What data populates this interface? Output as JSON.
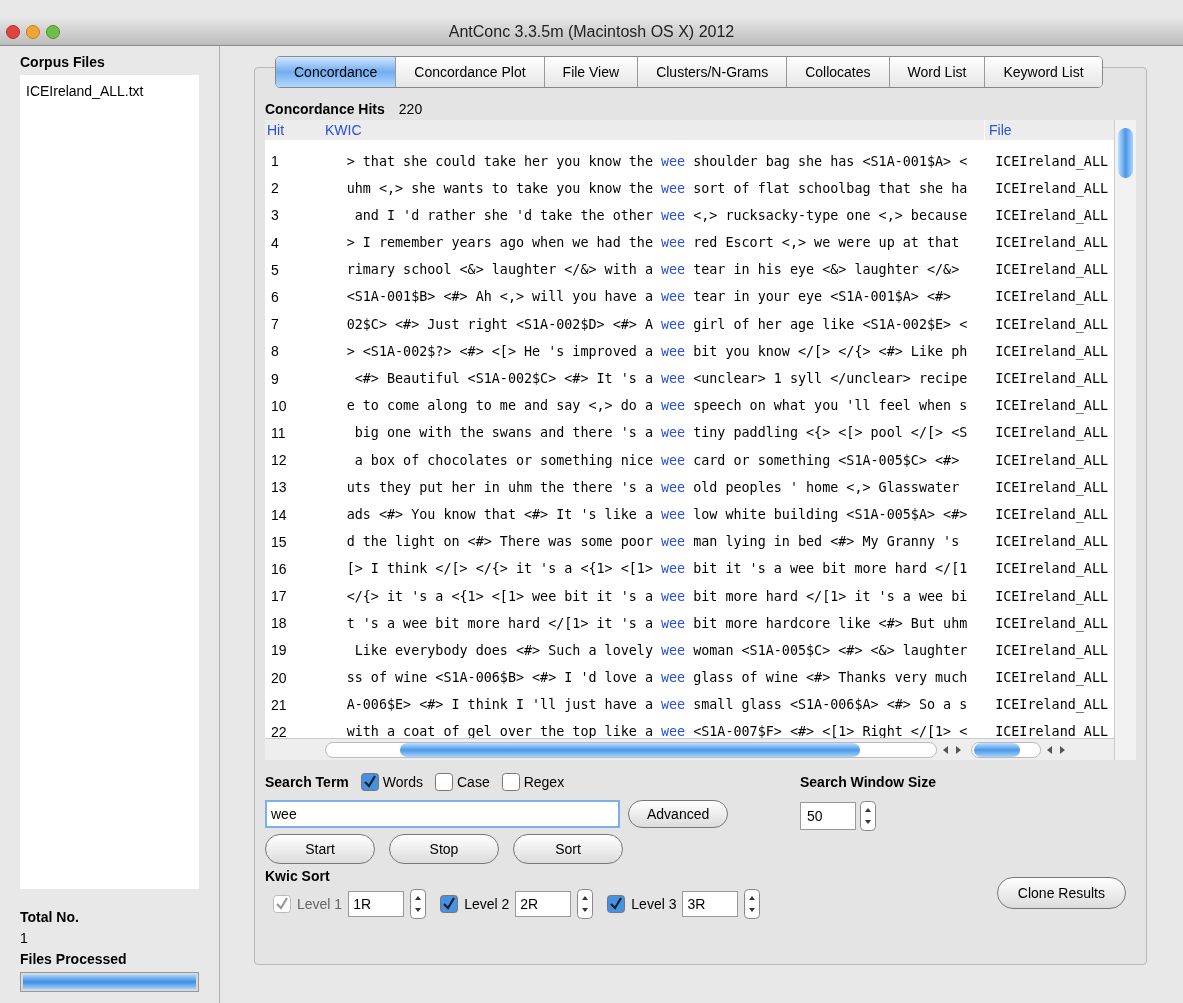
{
  "window": {
    "title": "AntConc 3.3.5m (Macintosh OS X) 2012"
  },
  "sidebar": {
    "title": "Corpus Files",
    "files": [
      {
        "name": "ICEIreland_ALL.txt",
        "selected": false
      }
    ],
    "total_label": "Total No.",
    "total_value": "1",
    "processed_label": "Files Processed",
    "progress": {
      "level": 1
    }
  },
  "tabs": [
    {
      "label": "Concordance",
      "selected": true
    },
    {
      "label": "Concordance Plot",
      "selected": false
    },
    {
      "label": "File View",
      "selected": false
    },
    {
      "label": "Clusters/N-Grams",
      "selected": false
    },
    {
      "label": "Collocates",
      "selected": false
    },
    {
      "label": "Word List",
      "selected": false
    },
    {
      "label": "Keyword List",
      "selected": false
    }
  ],
  "hits": {
    "label": "Concordance Hits",
    "value": "220"
  },
  "table": {
    "columns": [
      "Hit",
      "KWIC",
      "File"
    ],
    "rows": [
      {
        "hit": "1",
        "left": "> that she could take her you know the",
        "keyword": "wee",
        "right": "shoulder bag she has <S1A-001$A> <",
        "file": "ICEIreland_ALL"
      },
      {
        "hit": "2",
        "left": "uhm <,> she wants to take you know the",
        "keyword": "wee",
        "right": "sort of flat schoolbag that she ha",
        "file": "ICEIreland_ALL"
      },
      {
        "hit": "3",
        "left": " and I 'd rather she 'd take the other",
        "keyword": "wee",
        "right": "<,> rucksacky-type one <,> because",
        "file": "ICEIreland_ALL"
      },
      {
        "hit": "4",
        "left": "> I remember years ago when we had the",
        "keyword": "wee",
        "right": "red Escort <,> we were up at that",
        "file": "ICEIreland_ALL"
      },
      {
        "hit": "5",
        "left": "rimary school <&> laughter </&> with a",
        "keyword": "wee",
        "right": "tear in his eye <&> laughter </&>",
        "file": "ICEIreland_ALL"
      },
      {
        "hit": "6",
        "left": "<S1A-001$B> <#> Ah <,> will you have a",
        "keyword": "wee",
        "right": "tear in your eye <S1A-001$A> <#>",
        "file": "ICEIreland_ALL"
      },
      {
        "hit": "7",
        "left": "02$C> <#> Just right <S1A-002$D> <#> A",
        "keyword": "wee",
        "right": "girl of her age like <S1A-002$E> <",
        "file": "ICEIreland_ALL"
      },
      {
        "hit": "8",
        "left": "> <S1A-002$?> <#> <[> He 's improved a",
        "keyword": "wee",
        "right": "bit you know </[> </{> <#> Like ph",
        "file": "ICEIreland_ALL"
      },
      {
        "hit": "9",
        "left": " <#> Beautiful <S1A-002$C> <#> It 's a",
        "keyword": "wee",
        "right": "<unclear> 1 syll </unclear> recipe",
        "file": "ICEIreland_ALL"
      },
      {
        "hit": "10",
        "left": "e to come along to me and say <,> do a",
        "keyword": "wee",
        "right": "speech on what you 'll feel when s",
        "file": "ICEIreland_ALL"
      },
      {
        "hit": "11",
        "left": " big one with the swans and there 's a",
        "keyword": "wee",
        "right": "tiny paddling <{> <[> pool </[> <S",
        "file": "ICEIreland_ALL"
      },
      {
        "hit": "12",
        "left": " a box of chocolates or something nice",
        "keyword": "wee",
        "right": "card or something <S1A-005$C> <#>",
        "file": "ICEIreland_ALL"
      },
      {
        "hit": "13",
        "left": "uts they put her in uhm the there 's a",
        "keyword": "wee",
        "right": "old peoples ' home <,> Glasswater",
        "file": "ICEIreland_ALL"
      },
      {
        "hit": "14",
        "left": "ads <#> You know that <#> It 's like a",
        "keyword": "wee",
        "right": "low white building <S1A-005$A> <#>",
        "file": "ICEIreland_ALL"
      },
      {
        "hit": "15",
        "left": "d the light on <#> There was some poor",
        "keyword": "wee",
        "right": "man lying in bed <#> My Granny 's",
        "file": "ICEIreland_ALL"
      },
      {
        "hit": "16",
        "left": "[> I think </[> </{> it 's a <{1> <[1>",
        "keyword": "wee",
        "right": "bit it 's a wee bit more hard </[1",
        "file": "ICEIreland_ALL"
      },
      {
        "hit": "17",
        "left": "</{> it 's a <{1> <[1> wee bit it 's a",
        "keyword": "wee",
        "right": "bit more hard </[1> it 's a wee bi",
        "file": "ICEIreland_ALL"
      },
      {
        "hit": "18",
        "left": "t 's a wee bit more hard </[1> it 's a",
        "keyword": "wee",
        "right": "bit more hardcore like <#> But uhm",
        "file": "ICEIreland_ALL"
      },
      {
        "hit": "19",
        "left": " Like everybody does <#> Such a lovely",
        "keyword": "wee",
        "right": "woman <S1A-005$C> <#> <&> laughter",
        "file": "ICEIreland_ALL"
      },
      {
        "hit": "20",
        "left": "ss of wine <S1A-006$B> <#> I 'd love a",
        "keyword": "wee",
        "right": "glass of wine <#> Thanks very much",
        "file": "ICEIreland_ALL"
      },
      {
        "hit": "21",
        "left": "A-006$E> <#> I think I 'll just have a",
        "keyword": "wee",
        "right": "small glass <S1A-006$A> <#> So a s",
        "file": "ICEIreland_ALL"
      },
      {
        "hit": "22",
        "left": "with a coat of gel over the top like a",
        "keyword": "wee",
        "right": "<S1A-007$F> <#> <[1> Right </[1> <",
        "file": "ICEIreland_ALL"
      }
    ]
  },
  "search": {
    "label": "Search Term",
    "options": [
      {
        "label": "Words",
        "checked": true
      },
      {
        "label": "Case",
        "checked": false
      },
      {
        "label": "Regex",
        "checked": false
      }
    ],
    "value": "wee",
    "advanced": "Advanced"
  },
  "window_size": {
    "label": "Search Window Size",
    "value": "50"
  },
  "buttons": [
    "Start",
    "Stop",
    "Sort"
  ],
  "kwic_sort": {
    "label": "Kwic Sort",
    "levels": [
      {
        "label": "Level 1",
        "value": "1R",
        "checked": true,
        "disabled": true
      },
      {
        "label": "Level 2",
        "value": "2R",
        "checked": true,
        "disabled": false
      },
      {
        "label": "Level 3",
        "value": "3R",
        "checked": true,
        "disabled": false
      }
    ]
  },
  "clone": "Clone Results"
}
